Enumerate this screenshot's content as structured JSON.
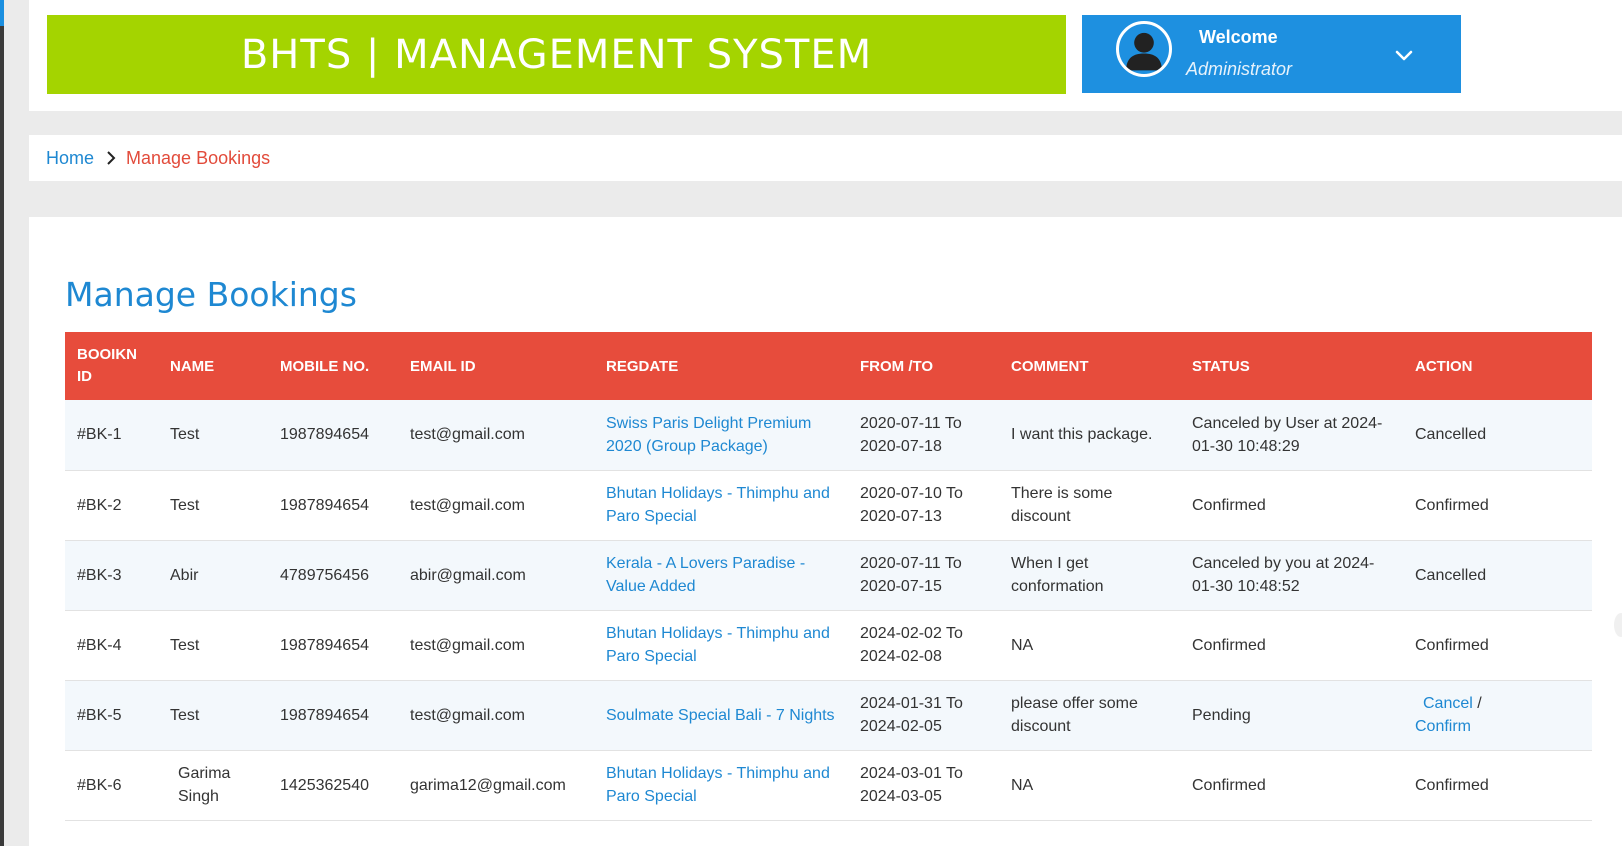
{
  "header": {
    "title": "BHTS | MANAGEMENT SYSTEM",
    "user": {
      "welcome": "Welcome",
      "role": "Administrator"
    }
  },
  "breadcrumb": {
    "home": "Home",
    "current": "Manage Bookings"
  },
  "page": {
    "title": "Manage Bookings"
  },
  "table": {
    "headers": [
      "BOOIKN ID",
      "NAME",
      "MOBILE NO.",
      "EMAIL ID",
      "REGDATE",
      "FROM /TO",
      "COMMENT",
      "STATUS",
      "ACTION"
    ],
    "rows": [
      {
        "id": "#BK-1",
        "name": "Test",
        "mobile": "1987894654",
        "email": "test@gmail.com",
        "package": "Swiss Paris Delight Premium 2020 (Group Package)",
        "dates": "2020-07-11 To 2020-07-18",
        "comment": "I want this package.",
        "status": "Canceled by User at 2024-01-30 10:48:29",
        "action": "Cancelled"
      },
      {
        "id": "#BK-2",
        "name": "Test",
        "mobile": "1987894654",
        "email": "test@gmail.com",
        "package": "Bhutan Holidays - Thimphu and Paro Special",
        "dates": "2020-07-10 To 2020-07-13",
        "comment": "There is some discount",
        "status": "Confirmed",
        "action": "Confirmed"
      },
      {
        "id": "#BK-3",
        "name": "Abir",
        "mobile": "4789756456",
        "email": "abir@gmail.com",
        "package": "Kerala - A Lovers Paradise - Value Added",
        "dates": "2020-07-11 To 2020-07-15",
        "comment": "When I get conformation",
        "status": "Canceled by you at 2024-01-30 10:48:52",
        "action": "Cancelled"
      },
      {
        "id": "#BK-4",
        "name": "Test",
        "mobile": "1987894654",
        "email": "test@gmail.com",
        "package": "Bhutan Holidays - Thimphu and Paro Special",
        "dates": "2024-02-02 To 2024-02-08",
        "comment": "NA",
        "status": "Confirmed",
        "action": "Confirmed"
      },
      {
        "id": "#BK-5",
        "name": "Test",
        "mobile": "1987894654",
        "email": "test@gmail.com",
        "package": "Soulmate Special Bali - 7 Nights",
        "dates": "2024-01-31 To 2024-02-05",
        "comment": "please offer some discount",
        "status": "Pending",
        "action_cancel": "Cancel",
        "action_sep": " /",
        "action_confirm": "Confirm"
      },
      {
        "id": "#BK-6",
        "name": "Garima Singh",
        "mobile": "1425362540",
        "email": "garima12@gmail.com",
        "package": "Bhutan Holidays - Thimphu and Paro Special",
        "dates": "2024-03-01 To 2024-03-05",
        "comment": "NA",
        "status": "Confirmed",
        "action": "Confirmed"
      }
    ]
  },
  "colors": {
    "brand": "#a4d400",
    "user_box": "#1e90e0",
    "table_header": "#e74c3c",
    "link": "#1e88d2",
    "breadcrumb_current": "#e24b3b"
  },
  "icons": {
    "avatar": "user-avatar-icon",
    "dropdown": "chevron-down-icon",
    "breadcrumb_separator": "chevron-right-icon"
  }
}
